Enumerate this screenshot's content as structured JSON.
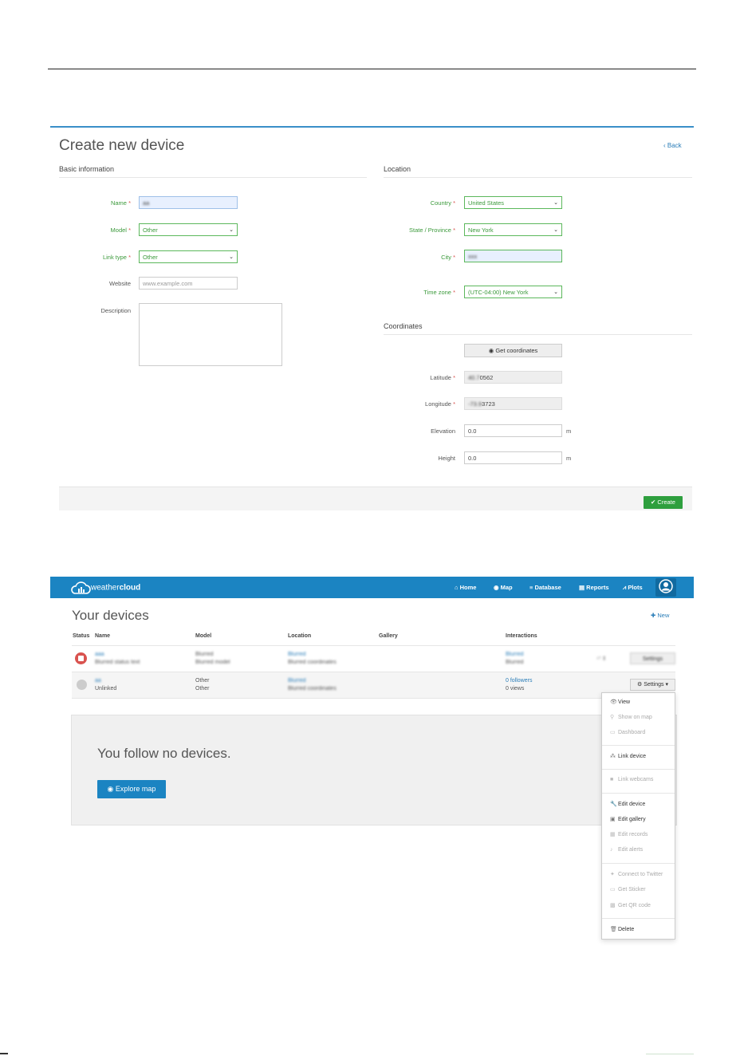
{
  "form": {
    "title": "Create new device",
    "back_label": "Back",
    "basic_info_heading": "Basic information",
    "location_heading": "Location",
    "coordinates_heading": "Coordinates",
    "name": {
      "label": "Name",
      "value": "aa"
    },
    "model": {
      "label": "Model",
      "value": "Other"
    },
    "link_type": {
      "label": "Link type",
      "value": "Other"
    },
    "website": {
      "label": "Website",
      "placeholder": "www.example.com"
    },
    "description": {
      "label": "Description"
    },
    "country": {
      "label": "Country",
      "value": "United States"
    },
    "state": {
      "label": "State / Province",
      "value": "New York"
    },
    "city": {
      "label": "City",
      "value": "xxx"
    },
    "timezone": {
      "label": "Time zone",
      "value": "(UTC-04:00) New York"
    },
    "get_coordinates_label": "Get coordinates",
    "latitude": {
      "label": "Latitude",
      "value_hidden": "40.7",
      "value_visible": "0562"
    },
    "longitude": {
      "label": "Longitude",
      "value_hidden": "-73.9",
      "value_visible": "3723"
    },
    "elevation": {
      "label": "Elevation",
      "value": "0.0",
      "unit": "m"
    },
    "height": {
      "label": "Height",
      "value": "0.0",
      "unit": "m"
    },
    "create_label": "Create",
    "required_mark": "*"
  },
  "navbar": {
    "logo_prefix": "weather",
    "logo_suffix": "cloud",
    "items": [
      {
        "label": "Home",
        "icon": "home-icon"
      },
      {
        "label": "Map",
        "icon": "globe-icon"
      },
      {
        "label": "Database",
        "icon": "database-icon"
      },
      {
        "label": "Reports",
        "icon": "document-icon"
      },
      {
        "label": "Plots",
        "icon": "chart-icon"
      }
    ]
  },
  "devices": {
    "title": "Your devices",
    "new_label": "New",
    "columns": [
      "Status",
      "Name",
      "Model",
      "Location",
      "Gallery",
      "Interactions"
    ],
    "rows": [
      {
        "name": "aaa",
        "sub": "Blurred status text",
        "model": "Blurred",
        "model_sub": "Blurred model",
        "location": "Blurred",
        "location_sub": "Blurred coordinates",
        "interactions": "Blurred",
        "interactions_sub": "Blurred",
        "settings": "Settings"
      },
      {
        "name": "aa",
        "sub": "Unlinked",
        "model": "Other",
        "model_sub": "Other",
        "location": "Blurred",
        "location_sub": "Blurred coordinates",
        "interactions": "0 followers",
        "interactions_sub": "0 views",
        "settings": "Settings"
      }
    ],
    "follow_text": "You follow no devices.",
    "explore_label": "Explore map"
  },
  "settings_menu": {
    "items": [
      {
        "label": "View",
        "icon": "eye-icon",
        "enabled": true
      },
      {
        "label": "Show on map",
        "icon": "pin-icon",
        "enabled": false
      },
      {
        "label": "Dashboard",
        "icon": "monitor-icon",
        "enabled": false
      },
      {
        "label": "Link device",
        "icon": "link-icon",
        "enabled": true
      },
      {
        "label": "Link webcams",
        "icon": "camera-icon",
        "enabled": false
      },
      {
        "label": "Edit device",
        "icon": "wrench-icon",
        "enabled": true
      },
      {
        "label": "Edit gallery",
        "icon": "image-icon",
        "enabled": true
      },
      {
        "label": "Edit records",
        "icon": "calendar-icon",
        "enabled": false
      },
      {
        "label": "Edit alerts",
        "icon": "bell-icon",
        "enabled": false
      },
      {
        "label": "Connect to Twitter",
        "icon": "twitter-icon",
        "enabled": false
      },
      {
        "label": "Get Sticker",
        "icon": "sticker-icon",
        "enabled": false
      },
      {
        "label": "Get QR code",
        "icon": "qr-icon",
        "enabled": false
      },
      {
        "label": "Delete",
        "icon": "trash-icon",
        "enabled": true
      }
    ]
  }
}
